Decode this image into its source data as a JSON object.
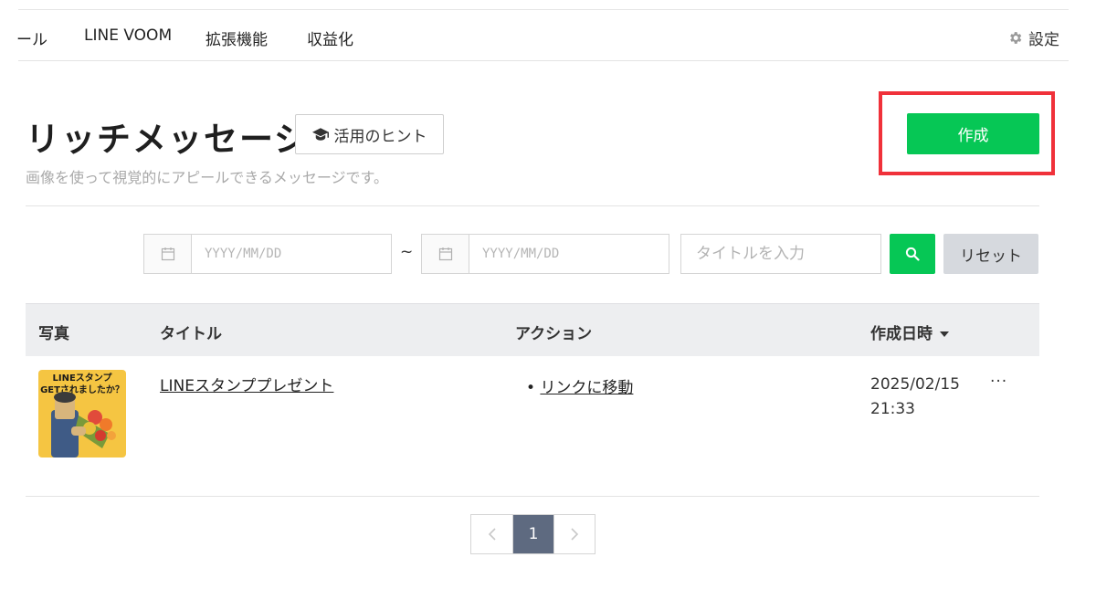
{
  "nav": {
    "items": [
      "ール",
      "LINE VOOM",
      "拡張機能",
      "収益化"
    ],
    "settings_label": "設定"
  },
  "header": {
    "title": "リッチメッセージ",
    "hint_label": "活用のヒント",
    "subtitle": "画像を使って視覚的にアピールできるメッセージです。",
    "create_label": "作成"
  },
  "filters": {
    "date_from_placeholder": "YYYY/MM/DD",
    "date_separator": "~",
    "date_to_placeholder": "YYYY/MM/DD",
    "title_placeholder": "タイトルを入力",
    "reset_label": "リセット"
  },
  "table": {
    "columns": [
      "写真",
      "タイトル",
      "アクション",
      "作成日時"
    ],
    "rows": [
      {
        "thumb_text_1": "LINEスタンプ",
        "thumb_text_2": "GETされましたか？",
        "title": "LINEスタンププレゼント",
        "action": "リンクに移動",
        "date": "2025/02/15",
        "time": "21:33",
        "more": "···"
      }
    ]
  },
  "pagination": {
    "current": "1"
  },
  "colors": {
    "brand_green": "#06c755",
    "highlight_red": "#f0313a",
    "pager_active": "#5e6a80"
  }
}
